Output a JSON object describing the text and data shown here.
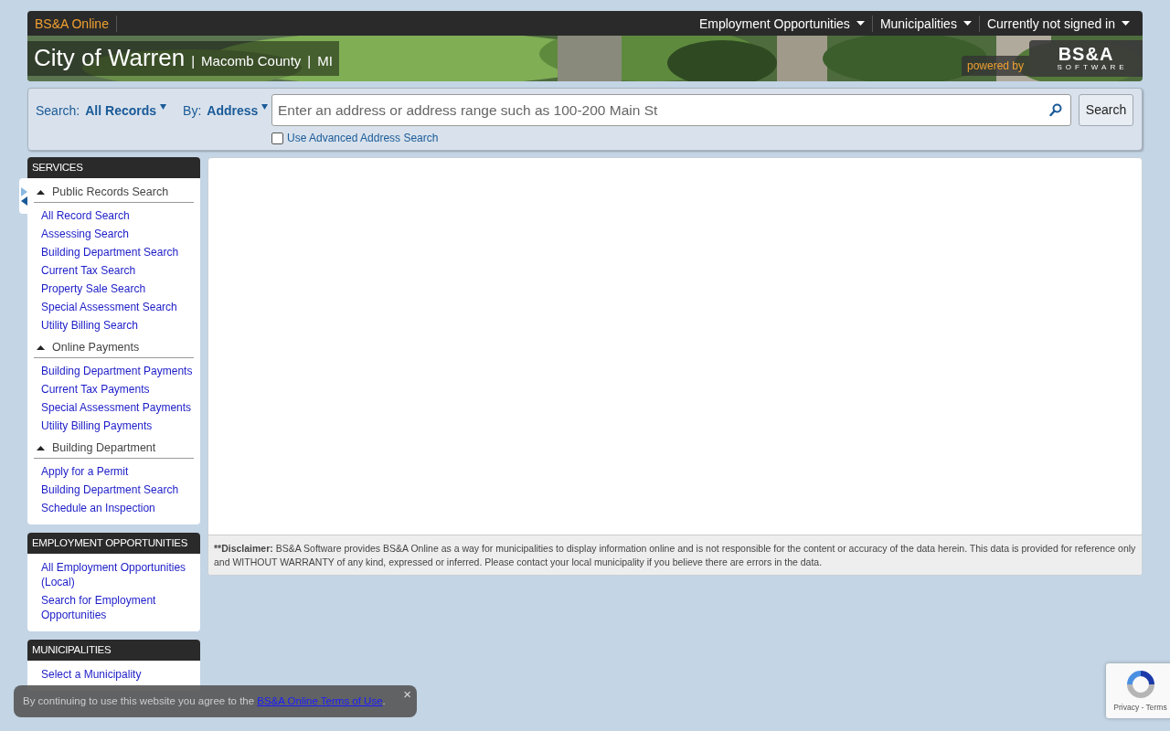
{
  "top_bar": {
    "brand": "BS&A Online",
    "menus": [
      {
        "label": "Employment Opportunities"
      },
      {
        "label": "Municipalities"
      },
      {
        "label": "Currently not signed in"
      }
    ]
  },
  "banner": {
    "title": "City of Warren",
    "separator_1": "|",
    "county": "Macomb County",
    "separator_2": "|",
    "state": "MI",
    "powered_by": "powered by",
    "logo_main": "BS&A",
    "logo_sub": "SOFTWARE"
  },
  "search": {
    "search_label": "Search:",
    "search_value": "All Records",
    "by_label": "By:",
    "by_value": "Address",
    "placeholder": "Enter an address or address range such as 100-200 Main St",
    "button": "Search",
    "advanced": {
      "label": "Use Advanced Address Search",
      "checked": false
    }
  },
  "sidebar": [
    {
      "title": "SERVICES",
      "groups": [
        {
          "title": "Public Records Search",
          "expanded": true,
          "links": [
            "All Record Search",
            "Assessing Search",
            "Building Department Search",
            "Current Tax Search",
            "Property Sale Search",
            "Special Assessment Search",
            "Utility Billing Search"
          ]
        },
        {
          "title": "Online Payments",
          "expanded": true,
          "links": [
            "Building Department Payments",
            "Current Tax Payments",
            "Special Assessment Payments",
            "Utility Billing Payments"
          ]
        },
        {
          "title": "Building Department",
          "expanded": true,
          "links": [
            "Apply for a Permit",
            "Building Department Search",
            "Schedule an Inspection"
          ]
        }
      ]
    },
    {
      "title": "EMPLOYMENT OPPORTUNITIES",
      "groups": [
        {
          "links": [
            "All Employment Opportunities (Local)",
            "Search for Employment Opportunities"
          ]
        }
      ]
    },
    {
      "title": "MUNICIPALITIES",
      "groups": [
        {
          "links": [
            "Select a Municipality"
          ]
        }
      ]
    }
  ],
  "disclaimer": {
    "label": "**Disclaimer:",
    "text": " BS&A Software provides BS&A Online as a way for municipalities to display information online and is not responsible for the content or accuracy of the data herein. This data is provided for reference only and WITHOUT WARRANTY of any kind, expressed or inferred. Please contact your local municipality if you believe there are errors in the data."
  },
  "cookie_notice": {
    "text": "By continuing to use this website you agree to the ",
    "link": "BS&A Online Terms of Use",
    "suffix": ".",
    "close": "×"
  },
  "recaptcha": {
    "privacy": "Privacy",
    "separator": " - ",
    "terms": "Terms"
  }
}
